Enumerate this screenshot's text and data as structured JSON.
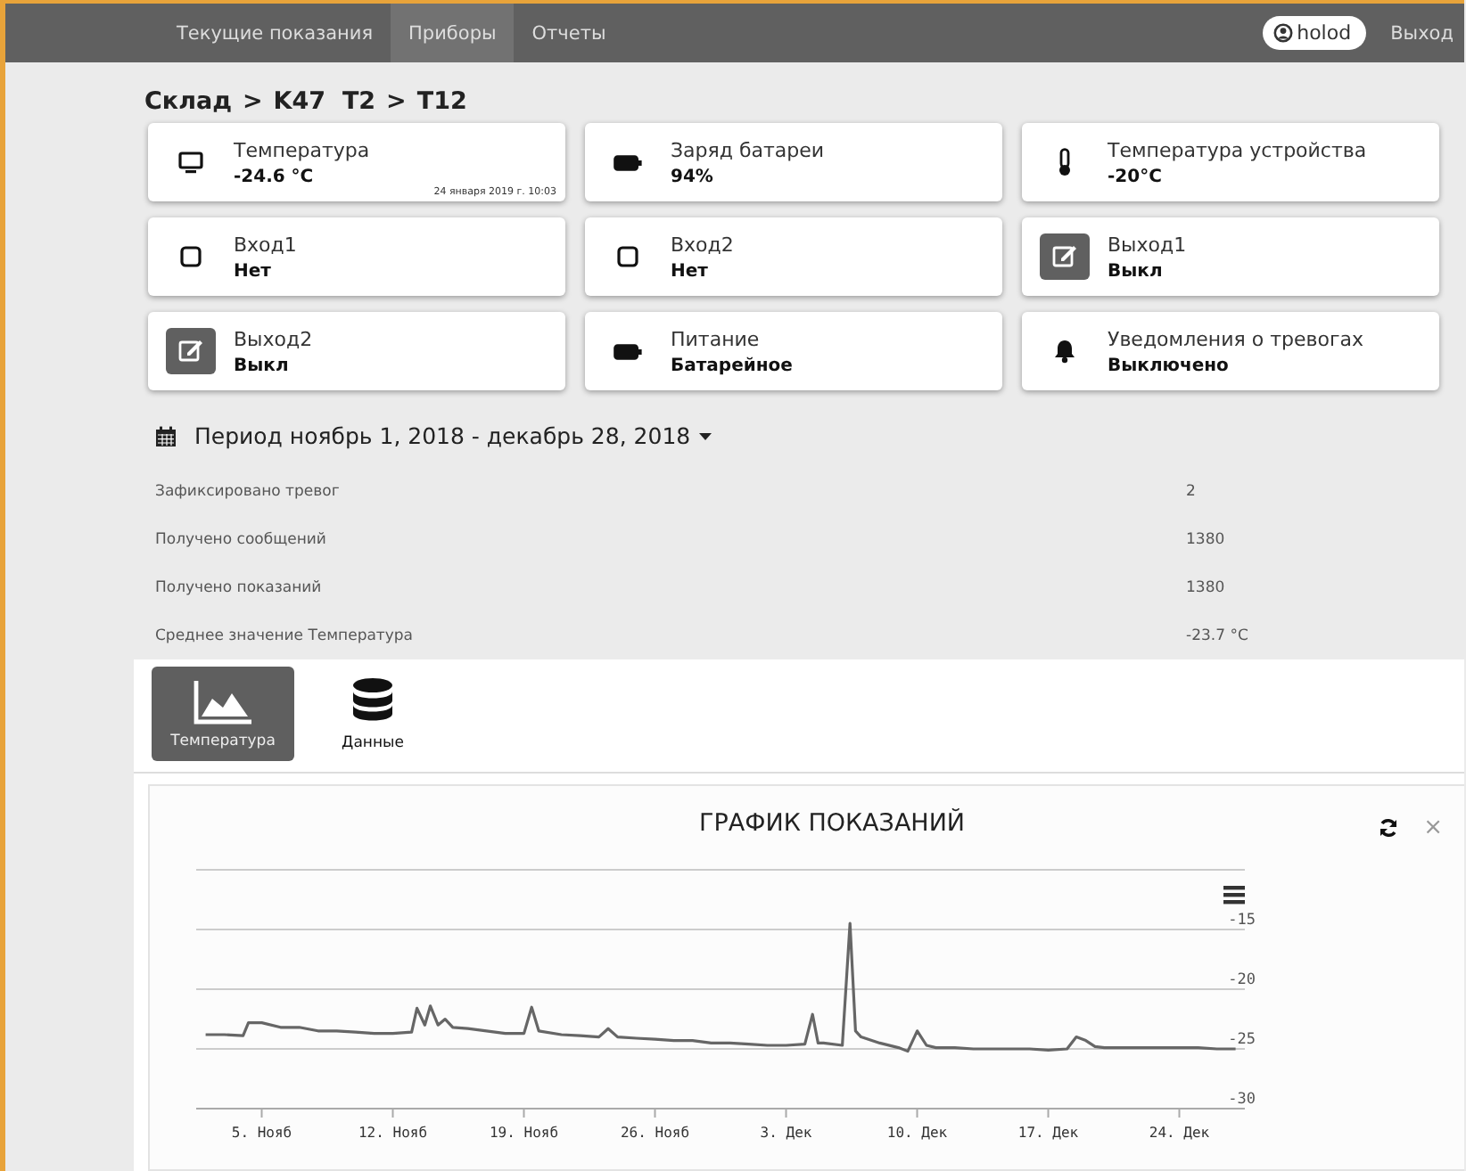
{
  "nav": {
    "items": [
      {
        "label": "Текущие показания",
        "selected": false
      },
      {
        "label": "Приборы",
        "selected": true
      },
      {
        "label": "Отчеты",
        "selected": false
      }
    ],
    "user": "holod",
    "logout": "Выход"
  },
  "breadcrumb": {
    "separator": ">",
    "items": [
      "Склад",
      "K47  T2",
      "T12"
    ]
  },
  "cards": [
    {
      "kind": "monitor",
      "label": "Температура",
      "value": "-24.6 °C",
      "timestamp": "24 января 2019 г. 10:03"
    },
    {
      "kind": "battery",
      "label": "Заряд батареи",
      "value": "94%"
    },
    {
      "kind": "thermometer",
      "label": "Температура устройства",
      "value": "-20°C"
    },
    {
      "kind": "square",
      "label": "Вход1",
      "value": "Нет"
    },
    {
      "kind": "square",
      "label": "Вход2",
      "value": "Нет"
    },
    {
      "kind": "edit",
      "label": "Выход1",
      "value": "Выкл"
    },
    {
      "kind": "edit",
      "label": "Выход2",
      "value": "Выкл"
    },
    {
      "kind": "battery",
      "label": "Питание",
      "value": "Батарейное"
    },
    {
      "kind": "bell",
      "label": "Уведомления о тревогах",
      "value": "Выключено"
    }
  ],
  "period": {
    "label": "Период ноябрь 1, 2018 - декабрь 28, 2018"
  },
  "stats": [
    {
      "label": "Зафиксировано тревог",
      "value": "2"
    },
    {
      "label": "Получено сообщений",
      "value": "1380"
    },
    {
      "label": "Получено показаний",
      "value": "1380"
    },
    {
      "label": "Среднее значение Температура",
      "value": "-23.7 °C"
    }
  ],
  "tabs": [
    {
      "label": "Температура",
      "kind": "area",
      "selected": true
    },
    {
      "label": "Данные",
      "kind": "database",
      "selected": false
    }
  ],
  "chart_panel": {
    "title": "ГРАФИК ПОКАЗАНИЙ",
    "close": "×",
    "chart_data": {
      "type": "line",
      "grid": true,
      "xlim": [
        "2018-11-01T12:00",
        "2018-12-27T12:00"
      ],
      "ylim": [
        -30,
        -10
      ],
      "xticks": [
        {
          "value": "2018-11-05T00:00",
          "label": "5. Нояб"
        },
        {
          "value": "2018-11-12T00:00",
          "label": "12. Нояб"
        },
        {
          "value": "2018-11-19T00:00",
          "label": "19. Нояб"
        },
        {
          "value": "2018-11-26T00:00",
          "label": "26. Нояб"
        },
        {
          "value": "2018-12-03T00:00",
          "label": "3. Дек"
        },
        {
          "value": "2018-12-10T00:00",
          "label": "10. Дек"
        },
        {
          "value": "2018-12-17T00:00",
          "label": "17. Дек"
        },
        {
          "value": "2018-12-24T00:00",
          "label": "24. Дек"
        }
      ],
      "yticks": [
        -15,
        -20,
        -25,
        -30
      ],
      "x": [
        "2018-11-02T00:00",
        "2018-11-03T00:00",
        "2018-11-04T00:00",
        "2018-11-04T07:00",
        "2018-11-05T00:00",
        "2018-11-06T00:00",
        "2018-11-07T00:00",
        "2018-11-08T00:00",
        "2018-11-09T00:00",
        "2018-11-10T00:00",
        "2018-11-11T00:00",
        "2018-11-12T00:00",
        "2018-11-13T00:00",
        "2018-11-13T07:00",
        "2018-11-13T17:00",
        "2018-11-14T00:00",
        "2018-11-14T10:00",
        "2018-11-14T19:00",
        "2018-11-15T05:00",
        "2018-11-16T00:00",
        "2018-11-17T00:00",
        "2018-11-18T00:00",
        "2018-11-19T00:00",
        "2018-11-19T10:00",
        "2018-11-19T19:00",
        "2018-11-21T00:00",
        "2018-11-22T00:00",
        "2018-11-23T00:00",
        "2018-11-23T12:00",
        "2018-11-24T00:00",
        "2018-11-25T00:00",
        "2018-11-26T00:00",
        "2018-11-27T00:00",
        "2018-11-28T00:00",
        "2018-11-29T00:00",
        "2018-11-30T00:00",
        "2018-12-01T00:00",
        "2018-12-02T00:00",
        "2018-12-03T00:00",
        "2018-12-04T00:00",
        "2018-12-04T10:00",
        "2018-12-04T17:00",
        "2018-12-05T00:00",
        "2018-12-06T00:00",
        "2018-12-06T10:00",
        "2018-12-06T17:00",
        "2018-12-07T00:00",
        "2018-12-08T00:00",
        "2018-12-09T00:00",
        "2018-12-09T12:00",
        "2018-12-10T00:00",
        "2018-12-10T12:00",
        "2018-12-11T00:00",
        "2018-12-12T00:00",
        "2018-12-13T00:00",
        "2018-12-14T00:00",
        "2018-12-15T00:00",
        "2018-12-16T00:00",
        "2018-12-17T00:00",
        "2018-12-18T00:00",
        "2018-12-18T12:00",
        "2018-12-19T00:00",
        "2018-12-19T12:00",
        "2018-12-20T00:00",
        "2018-12-21T00:00",
        "2018-12-22T00:00",
        "2018-12-23T00:00",
        "2018-12-24T00:00",
        "2018-12-25T00:00",
        "2018-12-26T00:00",
        "2018-12-27T00:00"
      ],
      "series": [
        {
          "color": "#666666",
          "values": [
            -23.8,
            -23.8,
            -23.9,
            -22.8,
            -22.8,
            -23.2,
            -23.2,
            -23.5,
            -23.5,
            -23.6,
            -23.7,
            -23.7,
            -23.6,
            -21.6,
            -23.0,
            -21.4,
            -23.0,
            -22.5,
            -23.2,
            -23.3,
            -23.5,
            -23.7,
            -23.7,
            -21.5,
            -23.5,
            -23.8,
            -23.9,
            -24.0,
            -23.3,
            -24.0,
            -24.1,
            -24.2,
            -24.3,
            -24.3,
            -24.5,
            -24.5,
            -24.6,
            -24.7,
            -24.7,
            -24.6,
            -22.1,
            -24.5,
            -24.5,
            -24.7,
            -14.5,
            -23.5,
            -24.0,
            -24.5,
            -24.9,
            -25.2,
            -23.5,
            -24.7,
            -24.9,
            -24.9,
            -25.0,
            -25.0,
            -25.0,
            -25.0,
            -25.1,
            -25.0,
            -24.0,
            -24.3,
            -24.8,
            -24.9,
            -24.9,
            -24.9,
            -24.9,
            -24.9,
            -24.9,
            -25.0,
            -25.0
          ]
        }
      ]
    }
  }
}
